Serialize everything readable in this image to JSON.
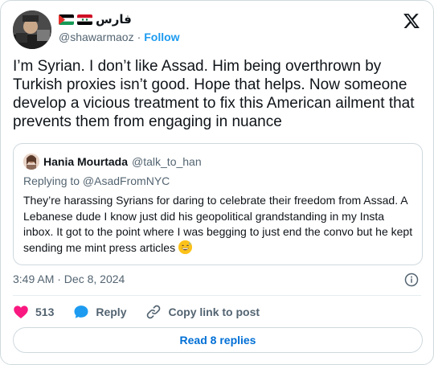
{
  "author": {
    "display_name": "فارس",
    "handle": "@shawarmaoz",
    "separator": "·",
    "follow_label": "Follow",
    "flags": [
      "palestine-flag",
      "syria-flag"
    ]
  },
  "tweet": {
    "text": "I’m Syrian. I don’t like Assad. Him being overthrown by Turkish proxies isn’t good. Hope that helps. Now someone develop a vicious treatment to fix this American ailment that prevents them from engaging in nuance",
    "timestamp": "3:49 AM · Dec 8, 2024"
  },
  "quoted": {
    "name": "Hania Mourtada",
    "handle": "@talk_to_han",
    "replying_to": "Replying to @AsadFromNYC",
    "text": "They’re harassing Syrians for daring to celebrate their freedom from Assad. A Lebanese dude I know just did his geopolitical grandstanding in my Insta inbox. It got to the point where I was begging to just end the convo but he kept sending me mint press articles",
    "emoji": "grinning-sweat-emoji"
  },
  "actions": {
    "like_count": "513",
    "reply_label": "Reply",
    "copy_label": "Copy link to post"
  },
  "footer": {
    "read_replies_label": "Read 8 replies"
  },
  "colors": {
    "accent": "#1d9bf0",
    "link_button": "#006fd6",
    "like": "#f91880",
    "muted": "#536471",
    "text": "#0f1419",
    "border": "#cfd9de"
  }
}
